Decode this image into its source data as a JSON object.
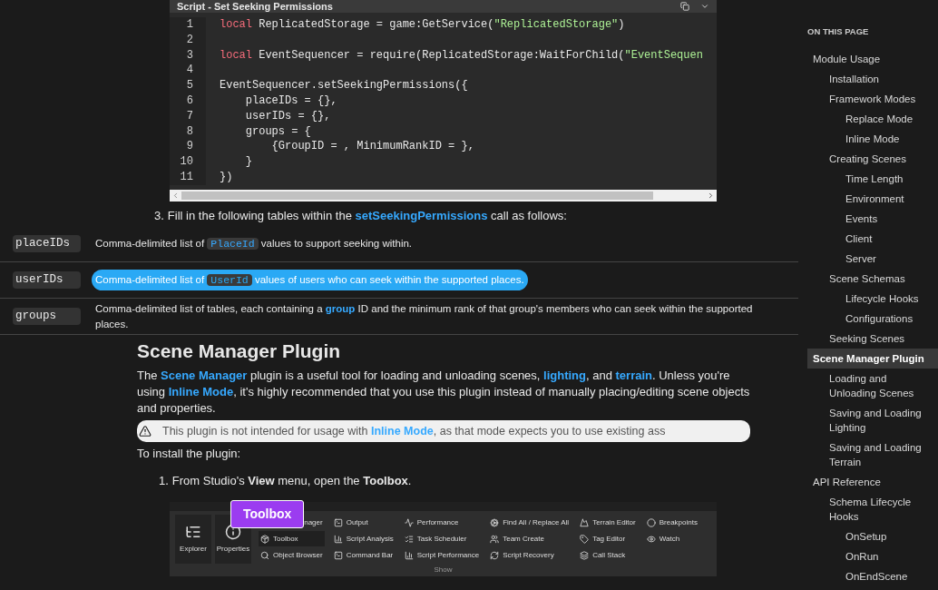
{
  "code_block": {
    "title": "Script - Set Seeking Permissions",
    "lines": [
      {
        "number": "1",
        "tokens": [
          {
            "kind": "keyword",
            "text": "local"
          },
          {
            "kind": "plain",
            "text": " ReplicatedStorage = game:GetService("
          },
          {
            "kind": "string",
            "text": "\"ReplicatedStorage\""
          },
          {
            "kind": "plain",
            "text": ")"
          }
        ]
      },
      {
        "number": "2"
      },
      {
        "number": "3",
        "tokens": [
          {
            "kind": "keyword",
            "text": "local"
          },
          {
            "kind": "plain",
            "text": " EventSequencer = require(ReplicatedStorage:WaitForChild("
          },
          {
            "kind": "string",
            "text": "\"EventSequen"
          }
        ]
      },
      {
        "number": "4"
      },
      {
        "number": "5",
        "tokens": [
          {
            "kind": "plain",
            "text": "EventSequencer.setSeekingPermissions({"
          }
        ]
      },
      {
        "number": "6",
        "tokens": [
          {
            "kind": "plain",
            "text": "    placeIDs = {},"
          }
        ]
      },
      {
        "number": "7",
        "tokens": [
          {
            "kind": "plain",
            "text": "    userIDs = {},"
          }
        ]
      },
      {
        "number": "8",
        "tokens": [
          {
            "kind": "plain",
            "text": "    groups = {"
          }
        ]
      },
      {
        "number": "9",
        "tokens": [
          {
            "kind": "plain",
            "text": "        {GroupID = , MinimumRankID = },"
          }
        ]
      },
      {
        "number": "10",
        "tokens": [
          {
            "kind": "plain",
            "text": "    }"
          }
        ]
      },
      {
        "number": "11",
        "tokens": [
          {
            "kind": "plain",
            "text": "})"
          }
        ]
      }
    ]
  },
  "step_3": {
    "number": "3.",
    "parts": [
      {
        "kind": "text",
        "text": "Fill in the following tables within the "
      },
      {
        "kind": "link",
        "text": "setSeekingPermissions"
      },
      {
        "kind": "text",
        "text": " call as follows:"
      }
    ]
  },
  "params_table": [
    {
      "name": "placeIDs",
      "highlighted": false,
      "parts": [
        {
          "kind": "text",
          "text": "Comma-delimited list of "
        },
        {
          "kind": "code",
          "text": "PlaceId"
        },
        {
          "kind": "text",
          "text": " values to support seeking within."
        }
      ]
    },
    {
      "name": "userIDs",
      "highlighted": true,
      "parts": [
        {
          "kind": "text",
          "text": "Comma-delimited list of "
        },
        {
          "kind": "code",
          "text": "UserId"
        },
        {
          "kind": "text",
          "text": " values of users who can seek within the supported places."
        }
      ]
    },
    {
      "name": "groups",
      "highlighted": false,
      "parts": [
        {
          "kind": "text",
          "text": "Comma-delimited list of tables, each containing a "
        },
        {
          "kind": "link",
          "text": "group"
        },
        {
          "kind": "text",
          "text": " ID and the minimum rank of that group's members who can seek within the supported places."
        }
      ]
    }
  ],
  "section": {
    "heading": "Scene Manager Plugin",
    "paragraph": [
      {
        "kind": "text",
        "text": "The "
      },
      {
        "kind": "link",
        "text": "Scene Manager"
      },
      {
        "kind": "text",
        "text": " plugin is a useful tool for loading and unloading scenes, "
      },
      {
        "kind": "link",
        "text": "lighting"
      },
      {
        "kind": "text",
        "text": ", and "
      },
      {
        "kind": "link",
        "text": "terrain"
      },
      {
        "kind": "text",
        "text": ". Unless you're using "
      },
      {
        "kind": "link",
        "text": "Inline Mode"
      },
      {
        "kind": "text",
        "text": ", it's highly recommended that you use this plugin instead of manually placing/editing scene objects and properties."
      }
    ],
    "callout": [
      {
        "kind": "text",
        "text": "This plugin is not intended for usage with "
      },
      {
        "kind": "link",
        "text": "Inline Mode"
      },
      {
        "kind": "text",
        "text": ", as that mode expects you to use existing ass"
      }
    ],
    "install_text": "To install the plugin:",
    "step_1": {
      "number": "1.",
      "parts": [
        {
          "kind": "text",
          "text": "From Studio's "
        },
        {
          "kind": "bold",
          "text": "View"
        },
        {
          "kind": "text",
          "text": " menu, open the "
        },
        {
          "kind": "bold",
          "text": "Toolbox"
        },
        {
          "kind": "text",
          "text": "."
        }
      ]
    }
  },
  "studio_toolbar": {
    "large_buttons": [
      {
        "label": "Explorer"
      },
      {
        "label": "Properties"
      }
    ],
    "columns": [
      [
        {
          "label": "nager",
          "selected": false
        },
        {
          "label": "Toolbox",
          "selected": true
        },
        {
          "label": "Object Browser",
          "selected": false
        }
      ],
      [
        {
          "label": "Output",
          "selected": false
        },
        {
          "label": "Script Analysis",
          "selected": false
        },
        {
          "label": "Command Bar",
          "selected": false
        }
      ],
      [
        {
          "label": "Performance",
          "selected": false
        },
        {
          "label": "Task Scheduler",
          "selected": false
        },
        {
          "label": "Script Performance",
          "selected": false
        }
      ],
      [
        {
          "label": "Find All / Replace All",
          "selected": false
        },
        {
          "label": "Team Create",
          "selected": false
        },
        {
          "label": "Script Recovery",
          "selected": false
        }
      ],
      [
        {
          "label": "Terrain Editor",
          "selected": false
        },
        {
          "label": "Tag Editor",
          "selected": false
        },
        {
          "label": "Call Stack",
          "selected": false
        }
      ],
      [
        {
          "label": "Breakpoints",
          "selected": false
        },
        {
          "label": "Watch",
          "selected": false
        }
      ]
    ],
    "group_label": "Show",
    "tooltip": "Toolbox"
  },
  "toc": {
    "heading": "ON THIS PAGE",
    "items": [
      {
        "label": "Module Usage",
        "selected": false,
        "children": [
          {
            "label": "Installation",
            "selected": false
          },
          {
            "label": "Framework Modes",
            "selected": false,
            "children": [
              {
                "label": "Replace Mode",
                "selected": false
              },
              {
                "label": "Inline Mode",
                "selected": false
              }
            ]
          },
          {
            "label": "Creating Scenes",
            "selected": false,
            "children": [
              {
                "label": "Time Length",
                "selected": false
              },
              {
                "label": "Environment",
                "selected": false
              },
              {
                "label": "Events",
                "selected": false
              },
              {
                "label": "Client",
                "selected": false
              },
              {
                "label": "Server",
                "selected": false
              }
            ]
          },
          {
            "label": "Scene Schemas",
            "selected": false,
            "children": [
              {
                "label": "Lifecycle Hooks",
                "selected": false
              },
              {
                "label": "Configurations",
                "selected": false
              }
            ]
          },
          {
            "label": "Seeking Scenes",
            "selected": false
          }
        ]
      },
      {
        "label": "Scene Manager Plugin",
        "selected": true,
        "children": [
          {
            "label": "Loading and Unloading Scenes",
            "selected": false
          },
          {
            "label": "Saving and Loading Lighting",
            "selected": false
          },
          {
            "label": "Saving and Loading Terrain",
            "selected": false
          }
        ]
      },
      {
        "label": "API Reference",
        "selected": false,
        "children": [
          {
            "label": "Schema Lifecycle Hooks",
            "selected": false,
            "children": [
              {
                "label": "OnSetup",
                "selected": false
              },
              {
                "label": "OnRun",
                "selected": false
              },
              {
                "label": "OnEndScene",
                "selected": false
              }
            ]
          }
        ]
      }
    ]
  }
}
